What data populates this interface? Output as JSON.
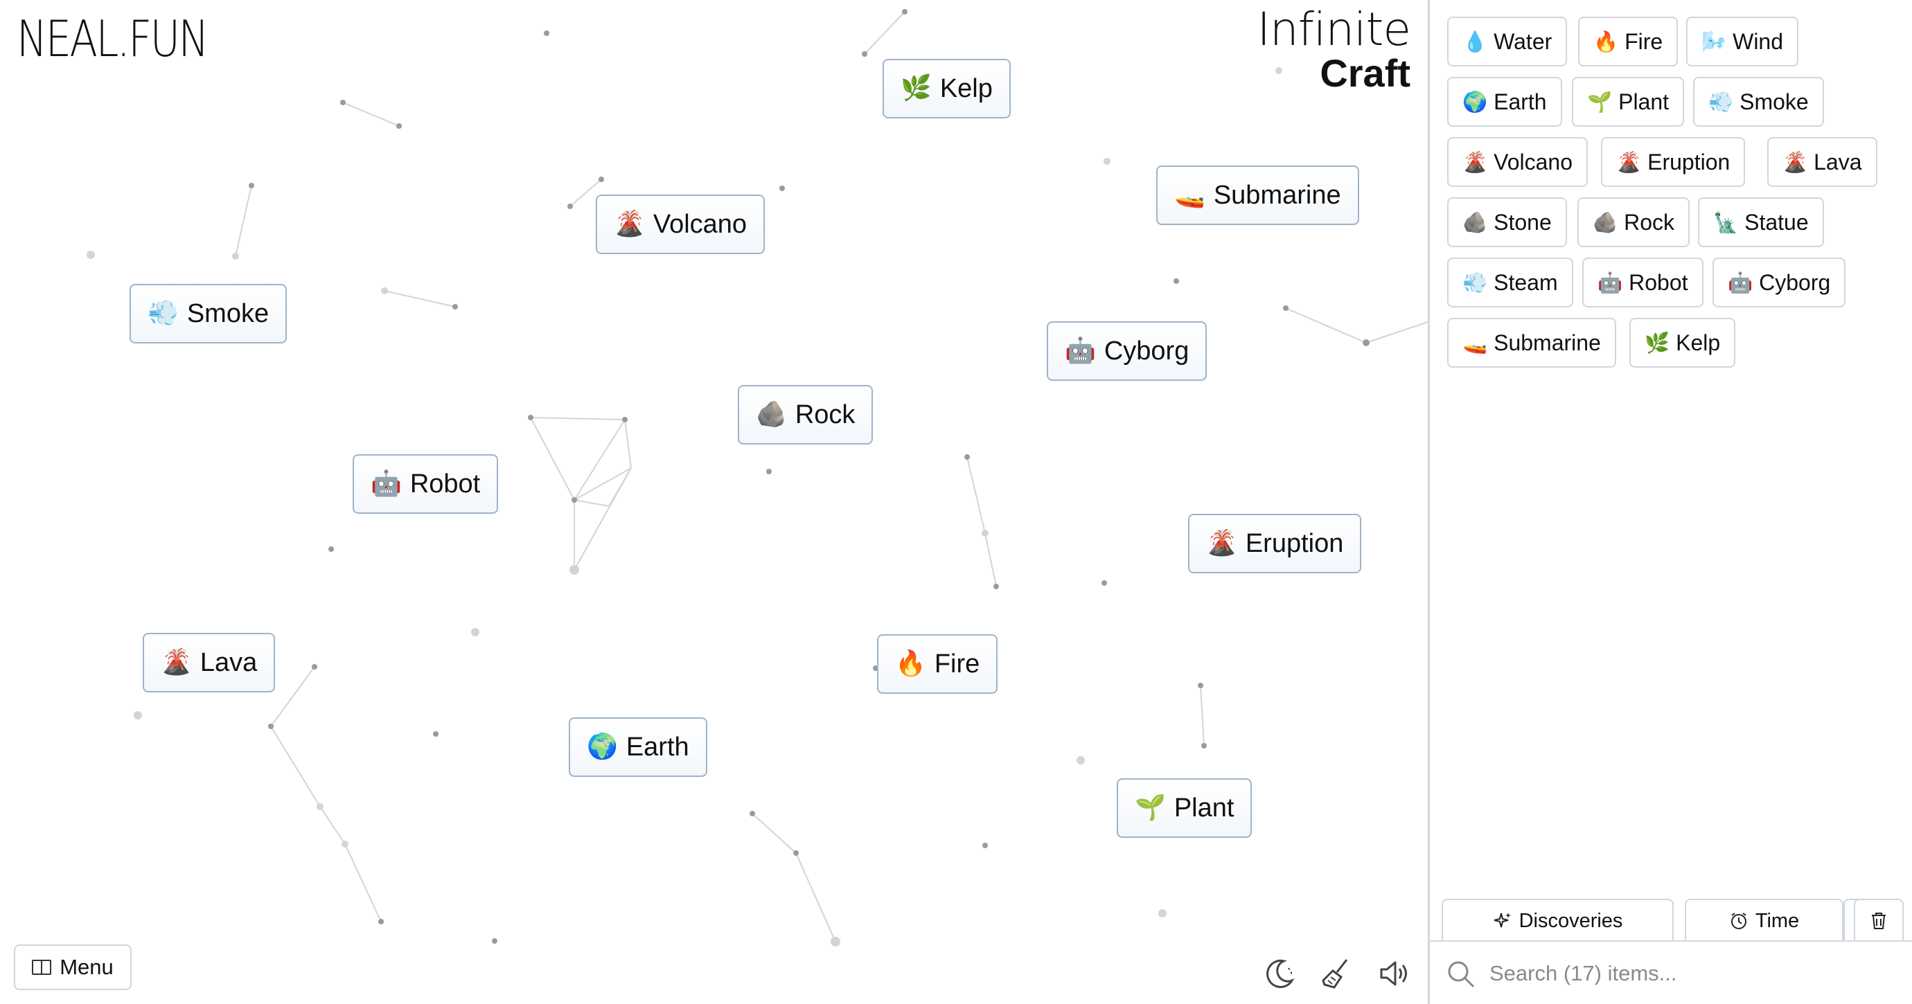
{
  "branding": {
    "site": "NEAL.FUN",
    "game_line1": "Infinite",
    "game_line2": "Craft"
  },
  "canvas": {
    "instances": [
      {
        "label": "Kelp",
        "icon": "kelp-icon",
        "emoji": "🌿"
      },
      {
        "label": "Volcano",
        "icon": "volcano-icon",
        "emoji": "🌋"
      },
      {
        "label": "Submarine",
        "icon": "submarine-icon",
        "emoji": "🚤"
      },
      {
        "label": "Smoke",
        "icon": "smoke-icon",
        "emoji": "💨"
      },
      {
        "label": "Cyborg",
        "icon": "robot-icon",
        "emoji": "🤖"
      },
      {
        "label": "Rock",
        "icon": "rock-icon",
        "emoji": "🪨"
      },
      {
        "label": "Robot",
        "icon": "robot-icon",
        "emoji": "🤖"
      },
      {
        "label": "Eruption",
        "icon": "volcano-icon",
        "emoji": "🌋"
      },
      {
        "label": "Lava",
        "icon": "volcano-icon",
        "emoji": "🌋"
      },
      {
        "label": "Fire",
        "icon": "fire-icon",
        "emoji": "🔥"
      },
      {
        "label": "Earth",
        "icon": "globe-icon",
        "emoji": "🌍"
      },
      {
        "label": "Plant",
        "icon": "seedling-icon",
        "emoji": "🌱"
      }
    ]
  },
  "footer": {
    "menu_label": "Menu"
  },
  "sidebar": {
    "items": [
      {
        "label": "Water",
        "icon": "droplet-icon",
        "emoji": "💧"
      },
      {
        "label": "Fire",
        "icon": "fire-icon",
        "emoji": "🔥"
      },
      {
        "label": "Wind",
        "icon": "wind-icon",
        "emoji": "🌬️"
      },
      {
        "label": "Earth",
        "icon": "globe-icon",
        "emoji": "🌍"
      },
      {
        "label": "Plant",
        "icon": "seedling-icon",
        "emoji": "🌱"
      },
      {
        "label": "Smoke",
        "icon": "smoke-icon",
        "emoji": "💨"
      },
      {
        "label": "Volcano",
        "icon": "volcano-icon",
        "emoji": "🌋"
      },
      {
        "label": "Eruption",
        "icon": "volcano-icon",
        "emoji": "🌋"
      },
      {
        "label": "Lava",
        "icon": "volcano-icon",
        "emoji": "🌋"
      },
      {
        "label": "Stone",
        "icon": "rock-icon",
        "emoji": "🪨"
      },
      {
        "label": "Rock",
        "icon": "rock-icon",
        "emoji": "🪨"
      },
      {
        "label": "Statue",
        "icon": "statue-icon",
        "emoji": "🗽"
      },
      {
        "label": "Steam",
        "icon": "smoke-icon",
        "emoji": "💨"
      },
      {
        "label": "Robot",
        "icon": "robot-icon",
        "emoji": "🤖"
      },
      {
        "label": "Cyborg",
        "icon": "robot-icon",
        "emoji": "🤖"
      },
      {
        "label": "Submarine",
        "icon": "submarine-icon",
        "emoji": "🚤"
      },
      {
        "label": "Kelp",
        "icon": "kelp-icon",
        "emoji": "🌿"
      }
    ],
    "tabs": {
      "discoveries": "Discoveries",
      "time": "Time"
    },
    "search": {
      "placeholder": "Search (17) items..."
    }
  }
}
